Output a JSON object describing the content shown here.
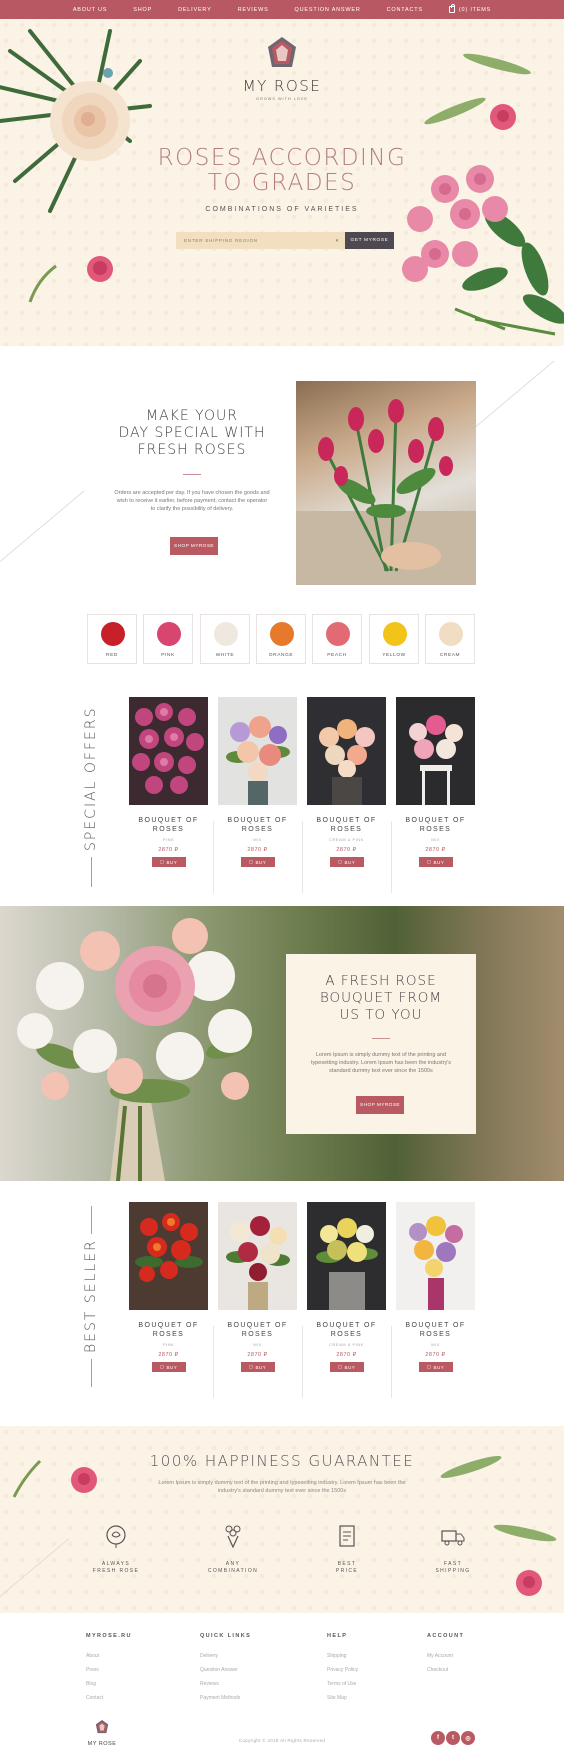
{
  "nav": {
    "items": [
      "ABOUT US",
      "SHOP",
      "DELIVERY",
      "REVIEWS",
      "QUESTION ANSWER",
      "CONTACTS"
    ],
    "cart": "(0) ITEMS"
  },
  "hero": {
    "brand": "MY ROSE",
    "tagline": "GROWS WITH LOVE",
    "title_line1": "ROSES ACCORDING",
    "title_line2": "TO GRADES",
    "subtitle": "COMBINATIONS OF VARIETIES",
    "region_placeholder": "ENTER SHIPPING REGION",
    "button": "GET MYROSE"
  },
  "promo": {
    "title_line1": "MAKE YOUR",
    "title_line2": "DAY SPECIAL WITH",
    "title_line3": "FRESH ROSES",
    "text": "Orders are accepted per day. If you have chosen the goods and wish to receive it earlier, before payment, contact the operator to clarify the possibility of delivery.",
    "button": "SHOP MYROSE"
  },
  "colors": [
    {
      "label": "RED",
      "hex": "#c8202a"
    },
    {
      "label": "PINK",
      "hex": "#d8456f"
    },
    {
      "label": "WHITE",
      "hex": "#efe8de"
    },
    {
      "label": "ORANGE",
      "hex": "#e7792c"
    },
    {
      "label": "PEACH",
      "hex": "#e26a74"
    },
    {
      "label": "YELLOW",
      "hex": "#f2c319"
    },
    {
      "label": "CREAM",
      "hex": "#f1dcc4"
    }
  ],
  "special_offers": {
    "title": "SPECIAL OFFERS",
    "products": [
      {
        "name_line1": "BOUQUET OF",
        "name_line2": "ROSES",
        "type": "PINK",
        "price": "2870 ₽",
        "buy": "BUY"
      },
      {
        "name_line1": "BOUQUET OF",
        "name_line2": "ROSES",
        "type": "MIX",
        "price": "2870 ₽",
        "buy": "BUY"
      },
      {
        "name_line1": "BOUQUET OF",
        "name_line2": "ROSES",
        "type": "CREAM & PINK",
        "price": "2870 ₽",
        "buy": "BUY"
      },
      {
        "name_line1": "BOUQUET OF",
        "name_line2": "ROSES",
        "type": "MIX",
        "price": "2870 ₽",
        "buy": "BUY"
      }
    ]
  },
  "band": {
    "title_line1": "A FRESH ROSE",
    "title_line2": "BOUQUET FROM",
    "title_line3": "US TO YOU",
    "text": "Lorem Ipsum is simply dummy text of the printing and typesetting industry. Lorem Ipsum has been the industry's standard dummy text ever since the 1500s",
    "button": "SHOP MYROSE"
  },
  "best_seller": {
    "title": "BEST SELLER",
    "products": [
      {
        "name_line1": "BOUQUET OF",
        "name_line2": "ROSES",
        "type": "PINK",
        "price": "2870 ₽",
        "buy": "BUY"
      },
      {
        "name_line1": "BOUQUET OF",
        "name_line2": "ROSES",
        "type": "MIX",
        "price": "2870 ₽",
        "buy": "BUY"
      },
      {
        "name_line1": "BOUQUET OF",
        "name_line2": "ROSES",
        "type": "CREAM & PINK",
        "price": "2870 ₽",
        "buy": "BUY"
      },
      {
        "name_line1": "BOUQUET OF",
        "name_line2": "ROSES",
        "type": "MIX",
        "price": "2870 ₽",
        "buy": "BUY"
      }
    ]
  },
  "guarantee": {
    "title": "100% HAPPINESS GUARANTEE",
    "text": "Lorem Ipsum is simply dummy text of the printing and typesetting industry. Lorem Ipsum has been the industry's standard dummy text ever since the 1500s",
    "features": [
      {
        "line1": "ALWAYS",
        "line2": "FRESH ROSE",
        "icon": "rose-icon"
      },
      {
        "line1": "ANY",
        "line2": "COMBINATION",
        "icon": "bouquet-icon"
      },
      {
        "line1": "BEST",
        "line2": "PRICE",
        "icon": "price-icon"
      },
      {
        "line1": "FAST",
        "line2": "SHIPPING",
        "icon": "truck-icon"
      }
    ]
  },
  "footer": {
    "columns": [
      {
        "title": "MYROSE.RU",
        "links": [
          "About",
          "Press",
          "Blog",
          "Contact"
        ]
      },
      {
        "title": "QUICK LINKS",
        "links": [
          "Delivery",
          "Question Answer",
          "Reviews",
          "Payment Methods"
        ]
      },
      {
        "title": "HELP",
        "links": [
          "Shipping",
          "Privacy Policy",
          "Terms of Use",
          "Site Map"
        ]
      },
      {
        "title": "ACCOUNT",
        "links": [
          "My Account",
          "Checkout"
        ]
      }
    ],
    "brand": "MY ROSE",
    "copyright": "Copyright © 2018 All Rights Reserved",
    "social": [
      {
        "glyph": "f",
        "icon": "facebook-icon"
      },
      {
        "glyph": "t",
        "icon": "twitter-icon"
      },
      {
        "glyph": "◎",
        "icon": "instagram-icon"
      }
    ]
  },
  "accent": "#b85862"
}
